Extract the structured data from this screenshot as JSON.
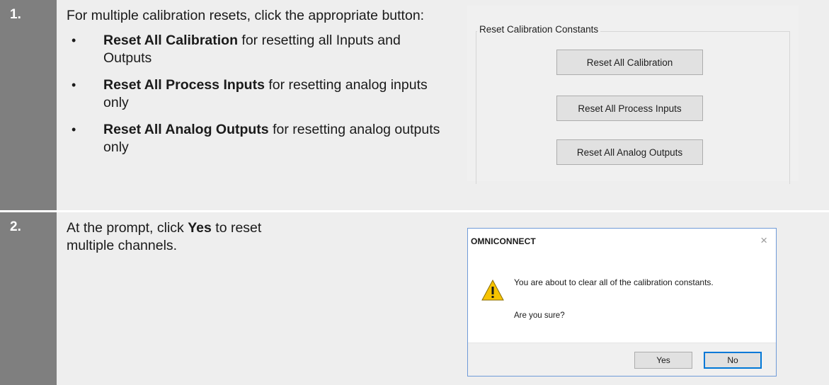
{
  "steps": [
    {
      "number": "1.",
      "intro": "For multiple calibration resets, click the appropriate button:",
      "bullets": [
        {
          "bold": "Reset All Calibration",
          "rest": " for resetting all Inputs and Outputs"
        },
        {
          "bold": "Reset All Process Inputs",
          "rest": " for resetting analog inputs only"
        },
        {
          "bold": "Reset All Analog Outputs",
          "rest": " for resetting analog outputs only"
        }
      ],
      "screenshot": {
        "group_title": "Reset Calibration Constants",
        "buttons": [
          "Reset All Calibration",
          "Reset All Process Inputs",
          "Reset All Analog Outputs"
        ]
      }
    },
    {
      "number": "2.",
      "text_before": "At the prompt, click ",
      "text_bold": "Yes",
      "text_after": " to reset multiple channels.",
      "dialog": {
        "title": "OMNICONNECT",
        "close_glyph": "×",
        "message": "You are about to clear all of the calibration constants.",
        "question": "Are you sure?",
        "yes_label": "Yes",
        "no_label": "No"
      }
    }
  ],
  "bullet_glyph": "•"
}
